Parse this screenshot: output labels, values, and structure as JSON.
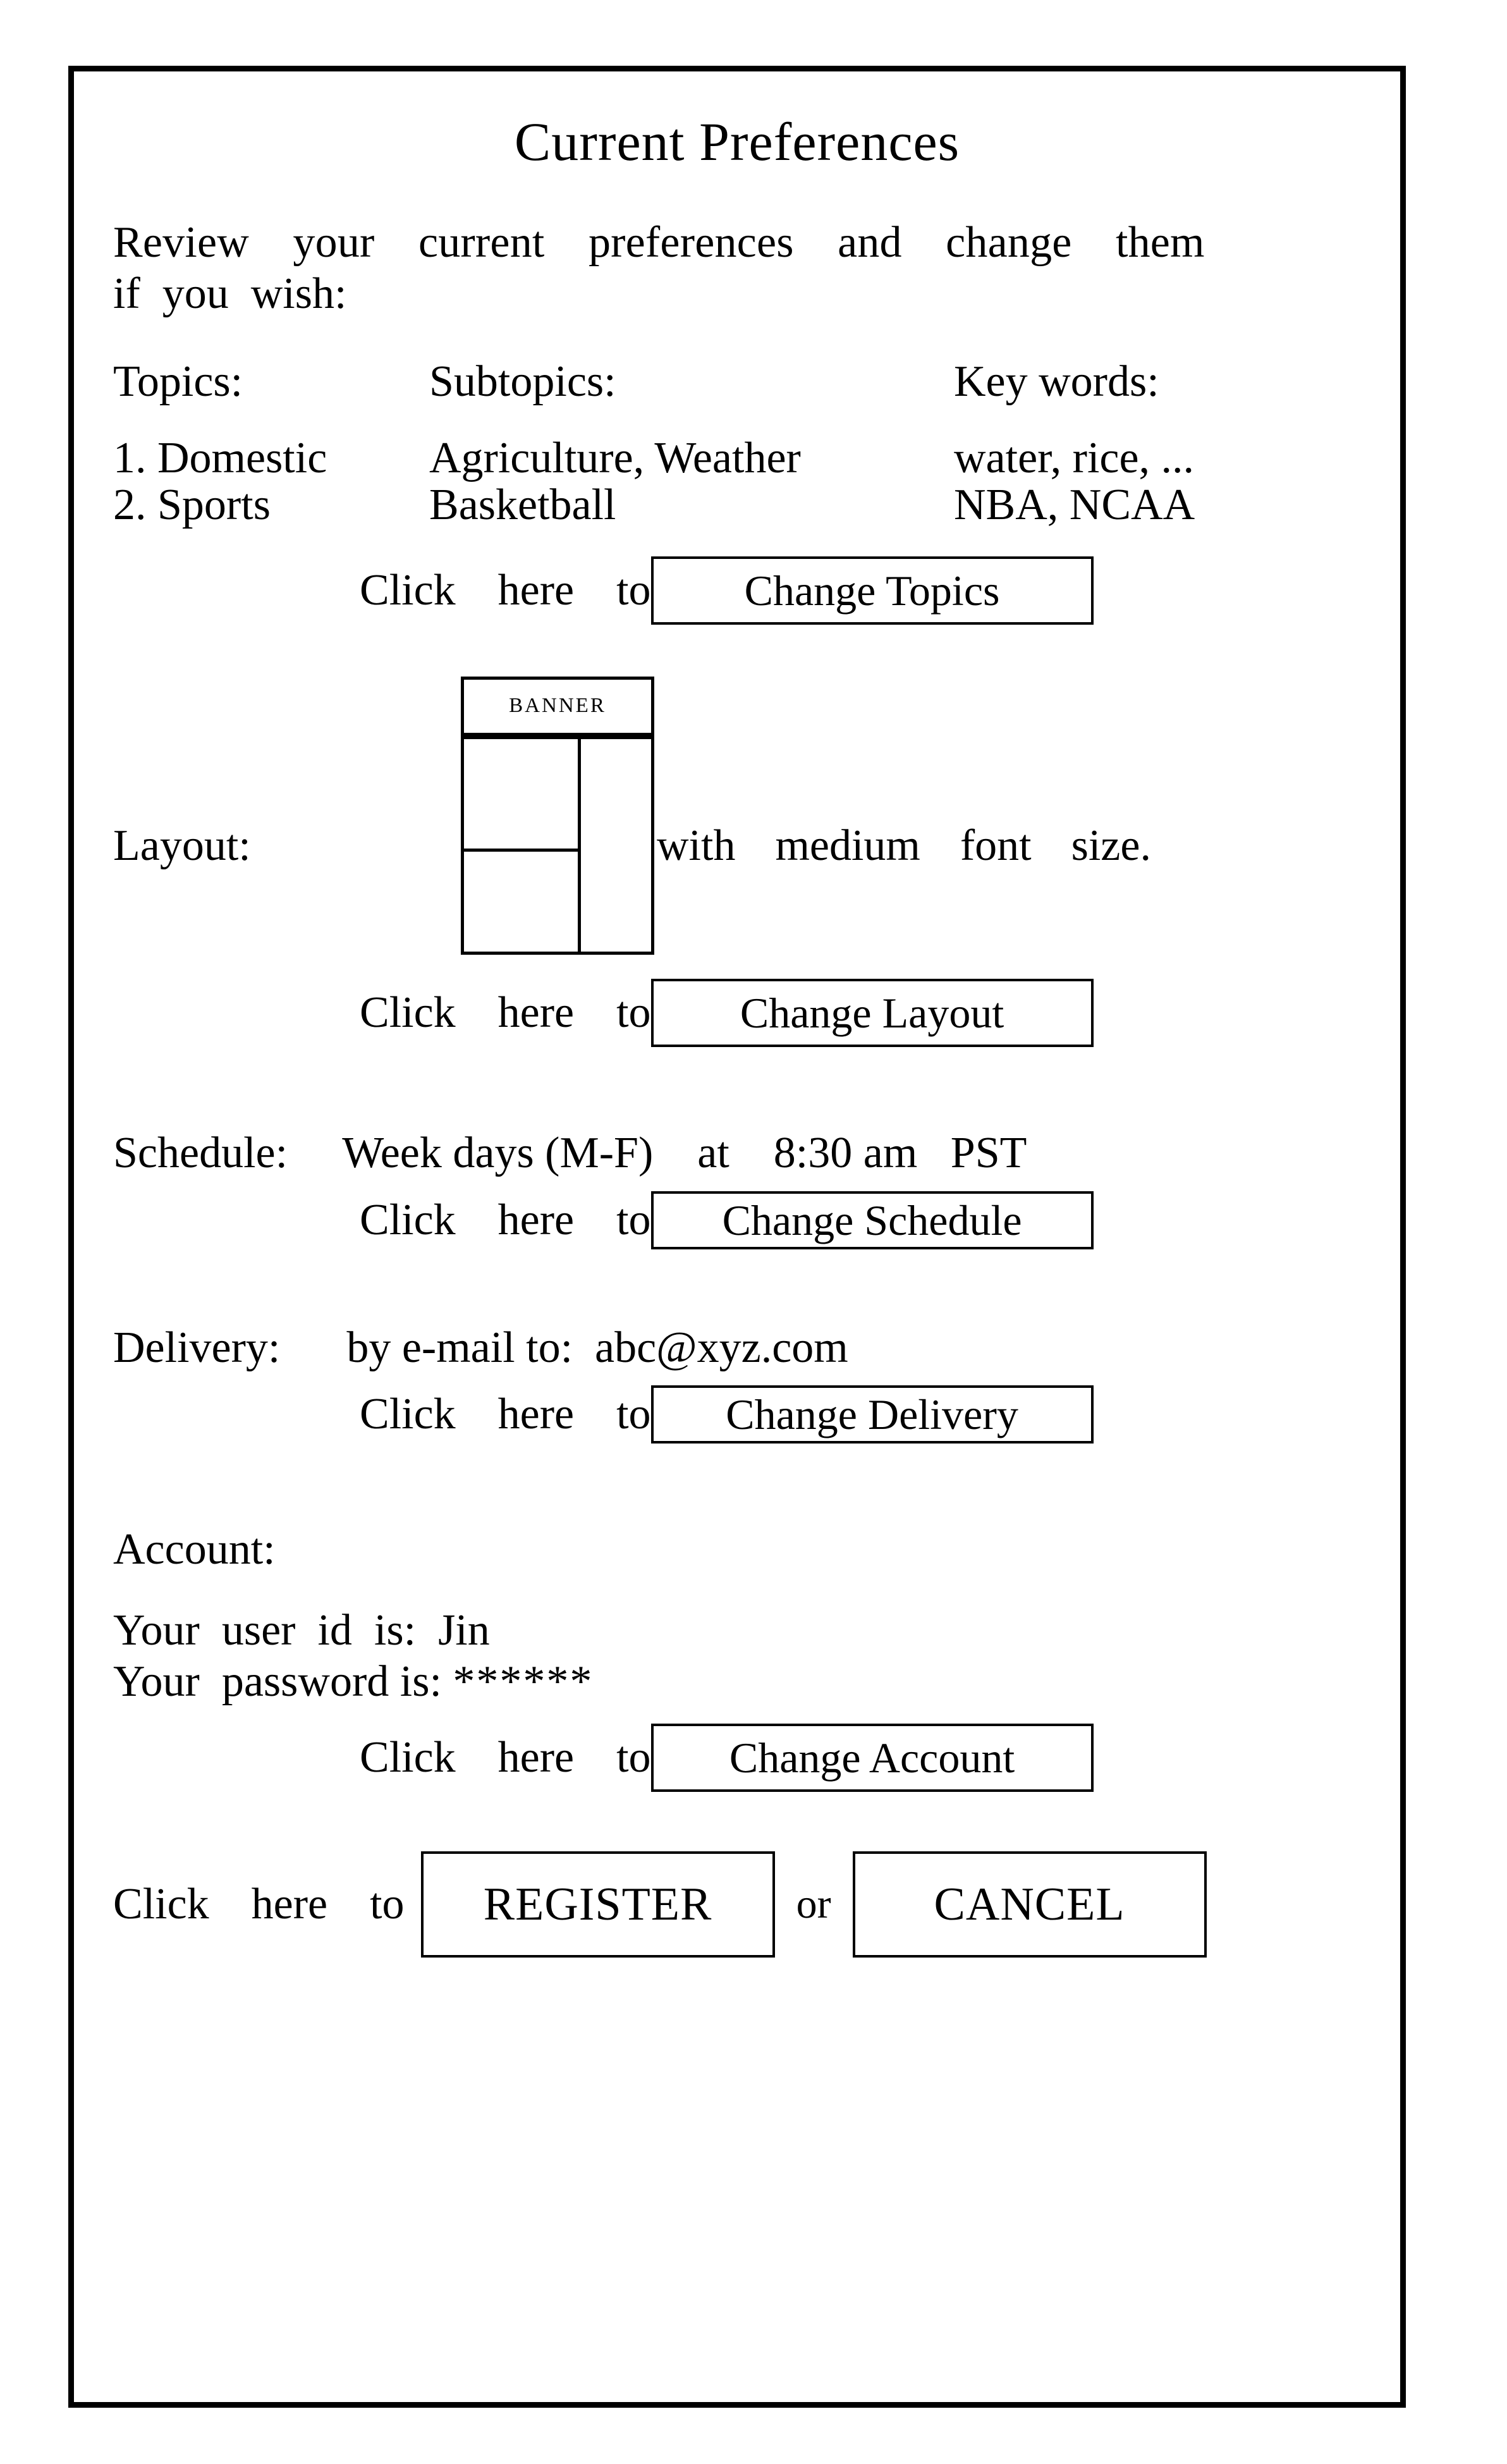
{
  "page": {
    "title": "Current Preferences",
    "intro": {
      "line1": "Review  your  current  preferences  and  change  them",
      "line2": "if  you  wish:"
    }
  },
  "topics": {
    "headers": {
      "topic": "Topics:",
      "subtopic": "Subtopics:",
      "keyword": "Key words:"
    },
    "rows": [
      {
        "topic": "1. Domestic",
        "subtopic": "Agriculture, Weather",
        "keyword": "water, rice, ..."
      },
      {
        "topic": "2. Sports",
        "subtopic": "Basketball",
        "keyword": "NBA, NCAA"
      }
    ],
    "click_label": "Click  here  to",
    "button_label": "Change Topics"
  },
  "layout": {
    "label": "Layout:",
    "banner_label": "BANNER",
    "note": "with  medium  font  size.",
    "click_label": "Click  here  to",
    "button_label": "Change Layout"
  },
  "schedule": {
    "text": "Schedule:     Week days (M-F)    at    8:30 am   PST",
    "click_label": "Click  here  to",
    "button_label": "Change Schedule"
  },
  "delivery": {
    "text": "Delivery:      by e-mail to:  abc@xyz.com",
    "click_label": "Click  here  to",
    "button_label": "Change Delivery"
  },
  "account": {
    "heading": "Account:",
    "userid_line": "Your  user  id  is:  Jin",
    "password_label": "Your  password is: ",
    "password_value": "******",
    "click_label": "Click  here  to",
    "button_label": "Change Account"
  },
  "actions": {
    "lead": "Click  here  to",
    "register_label": "REGISTER",
    "or_label": "or",
    "cancel_label": "CANCEL"
  },
  "colors": {
    "ink": "#000000",
    "paper": "#ffffff"
  }
}
